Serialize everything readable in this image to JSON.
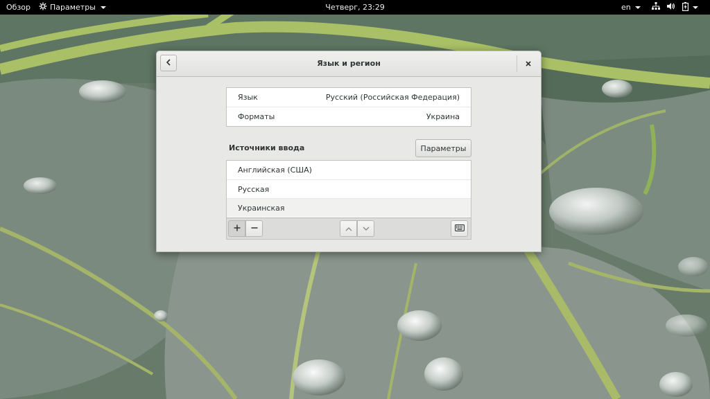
{
  "topbar": {
    "activities": "Обзор",
    "app_menu": "Параметры",
    "clock": "Четверг, 23:29",
    "keyboard_layout": "en",
    "icons": [
      "network-icon",
      "volume-icon",
      "battery-icon",
      "power-menu-arrow-icon"
    ]
  },
  "dialog": {
    "title": "Язык и регион",
    "icons": {
      "back": "chevron-left-icon",
      "close": "close-icon"
    },
    "settings": [
      {
        "label": "Язык",
        "value": "Русский (Российская Федерация)"
      },
      {
        "label": "Форматы",
        "value": "Украина"
      }
    ],
    "input_sources_label": "Источники ввода",
    "options_button": "Параметры",
    "input_sources": [
      "Английская (США)",
      "Русская",
      "Украинская"
    ],
    "selected_input_source": "Украинская",
    "toolbar_icons": [
      "add-icon",
      "remove-icon",
      "move-up-icon",
      "move-down-icon",
      "keyboard-layout-icon"
    ]
  },
  "colors": {
    "topbar_bg": "#000000",
    "dialog_bg": "#e8e8e7",
    "text": "#2e3436"
  }
}
